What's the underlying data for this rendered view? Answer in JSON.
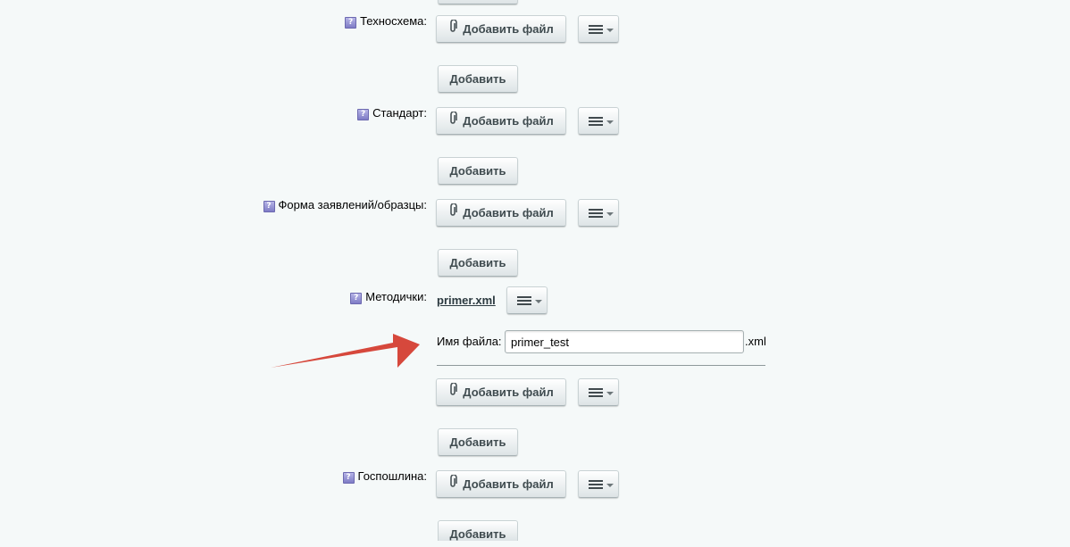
{
  "rows": [
    {
      "label": "Техносхема:",
      "help": "?"
    },
    {
      "label": "Стандарт:",
      "help": "?"
    },
    {
      "label": "Форма заявлений/образцы:",
      "help": "?"
    },
    {
      "label": "Методички:",
      "help": "?"
    },
    {
      "label": "Госпошлина:",
      "help": "?"
    }
  ],
  "buttons": {
    "add_file": "Добавить файл",
    "add": "Добавить"
  },
  "metodichki": {
    "file_link": "primer.xml",
    "filename_label": "Имя файла:",
    "filename_value": "primer_test",
    "extension": ".xml"
  },
  "colors": {
    "background": "#f5f9f9",
    "arrow": "#d6483c"
  }
}
